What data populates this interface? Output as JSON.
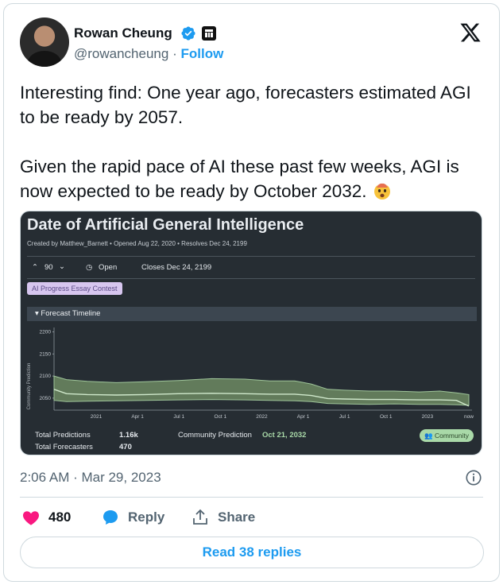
{
  "author": {
    "name": "Rowan Cheung",
    "handle": "@rowancheung",
    "separator": "·",
    "follow_label": "Follow"
  },
  "tweet": {
    "text": "Interesting find: One year ago, forecasters estimated AGI to be ready by 2057.\n\nGiven the rapid pace of AI these past few weeks, AGI is now expected to be ready by October 2032.",
    "emoji": "exploding-head-icon",
    "timestamp": "2:06 AM · Mar 29, 2023"
  },
  "media": {
    "title": "Date of Artificial General Intelligence",
    "meta": "Created by Matthew_Barnett • Opened Aug 22, 2020 • Resolves Dec 24, 2199",
    "vote_count": "90",
    "status": "Open",
    "closes": "Closes Dec 24, 2199",
    "tag": "AI Progress Essay Contest",
    "forecast_header": "Forecast Timeline",
    "stats": {
      "total_predictions_label": "Total Predictions",
      "total_predictions_value": "1.16k",
      "total_forecasters_label": "Total Forecasters",
      "total_forecasters_value": "470",
      "community_prediction_label": "Community Prediction",
      "community_prediction_value": "Oct 21, 2032",
      "community_pill": "Community"
    }
  },
  "chart_data": {
    "type": "area",
    "ylabel": "Community Prediction",
    "yticks": [
      "2200",
      "2150",
      "2100",
      "2050"
    ],
    "xticks": [
      "2021",
      "Apr 1",
      "Jul 1",
      "Oct 1",
      "2022",
      "Apr 1",
      "Jul 1",
      "Oct 1",
      "2023",
      "now"
    ],
    "ylim": [
      2030,
      2210
    ],
    "series": [
      {
        "kind": "band",
        "x": [
          0,
          0.03,
          0.08,
          0.15,
          0.22,
          0.3,
          0.38,
          0.46,
          0.52,
          0.58,
          0.62,
          0.66,
          0.7,
          0.76,
          0.82,
          0.88,
          0.93,
          0.97,
          1.0
        ],
        "upper": [
          2100,
          2092,
          2088,
          2085,
          2087,
          2090,
          2094,
          2093,
          2089,
          2089,
          2082,
          2070,
          2068,
          2066,
          2066,
          2064,
          2066,
          2062,
          2058
        ],
        "lower": [
          2045,
          2042,
          2043,
          2044,
          2045,
          2046,
          2047,
          2046,
          2045,
          2044,
          2042,
          2038,
          2037,
          2036,
          2037,
          2036,
          2036,
          2035,
          2034
        ]
      },
      {
        "kind": "median",
        "x": [
          0,
          0.03,
          0.08,
          0.15,
          0.22,
          0.3,
          0.38,
          0.46,
          0.52,
          0.58,
          0.62,
          0.66,
          0.7,
          0.76,
          0.82,
          0.88,
          0.93,
          0.97,
          1.0
        ],
        "values": [
          2070,
          2060,
          2058,
          2057,
          2058,
          2060,
          2061,
          2060,
          2059,
          2059,
          2056,
          2049,
          2048,
          2047,
          2047,
          2046,
          2046,
          2045,
          2032
        ]
      }
    ]
  },
  "actions": {
    "likes": "480",
    "reply_label": "Reply",
    "share_label": "Share",
    "read_replies": "Read 38 replies"
  },
  "colors": {
    "accent": "#1d9bf0",
    "like": "#f91880",
    "chart_band": "#6d8a63",
    "chart_line": "#b8ddb4"
  }
}
